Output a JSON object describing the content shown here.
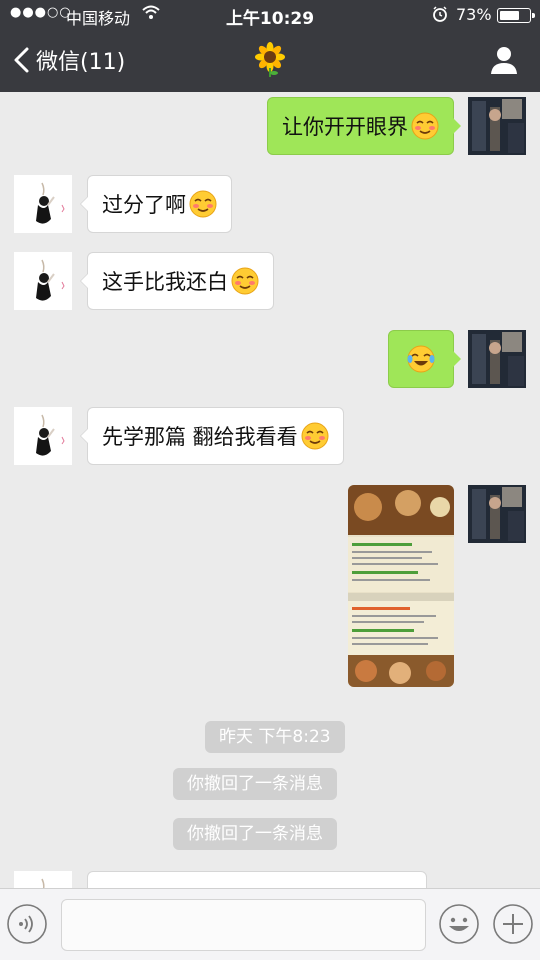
{
  "status_bar": {
    "signal": "●●●○○",
    "carrier": "中国移动",
    "time": "上午10:29",
    "battery_percent": "73%",
    "battery_level": 0.73
  },
  "nav": {
    "back_label": "微信(11)",
    "title_icon": "sunflower-emoji",
    "profile_icon": "person-icon"
  },
  "messages": [
    {
      "sender": "me",
      "text": "让你开开眼界",
      "emoji": "blush-emoji"
    },
    {
      "sender": "other",
      "text": "过分了啊",
      "emoji": "blush-emoji"
    },
    {
      "sender": "other",
      "text": "这手比我还白",
      "emoji": "blush-emoji"
    },
    {
      "sender": "me",
      "text": "",
      "emoji": "tears-of-joy-emoji"
    },
    {
      "sender": "other",
      "text": "先学那篇 翻给我看看",
      "emoji": "blush-emoji"
    },
    {
      "sender": "me",
      "type": "image",
      "description": "photo-of-menu"
    }
  ],
  "system_messages": {
    "timestamp": "昨天 下午8:23",
    "recall_1": "你撤回了一条消息",
    "recall_2": "你撤回了一条消息"
  },
  "input_bar": {
    "voice_icon": "voice-icon",
    "emoji_icon": "smiley-icon",
    "plus_icon": "plus-icon",
    "placeholder": ""
  },
  "colors": {
    "nav_background": "#393a3f",
    "chat_background": "#ebebeb",
    "my_bubble": "#9fe658",
    "their_bubble": "#ffffff"
  }
}
